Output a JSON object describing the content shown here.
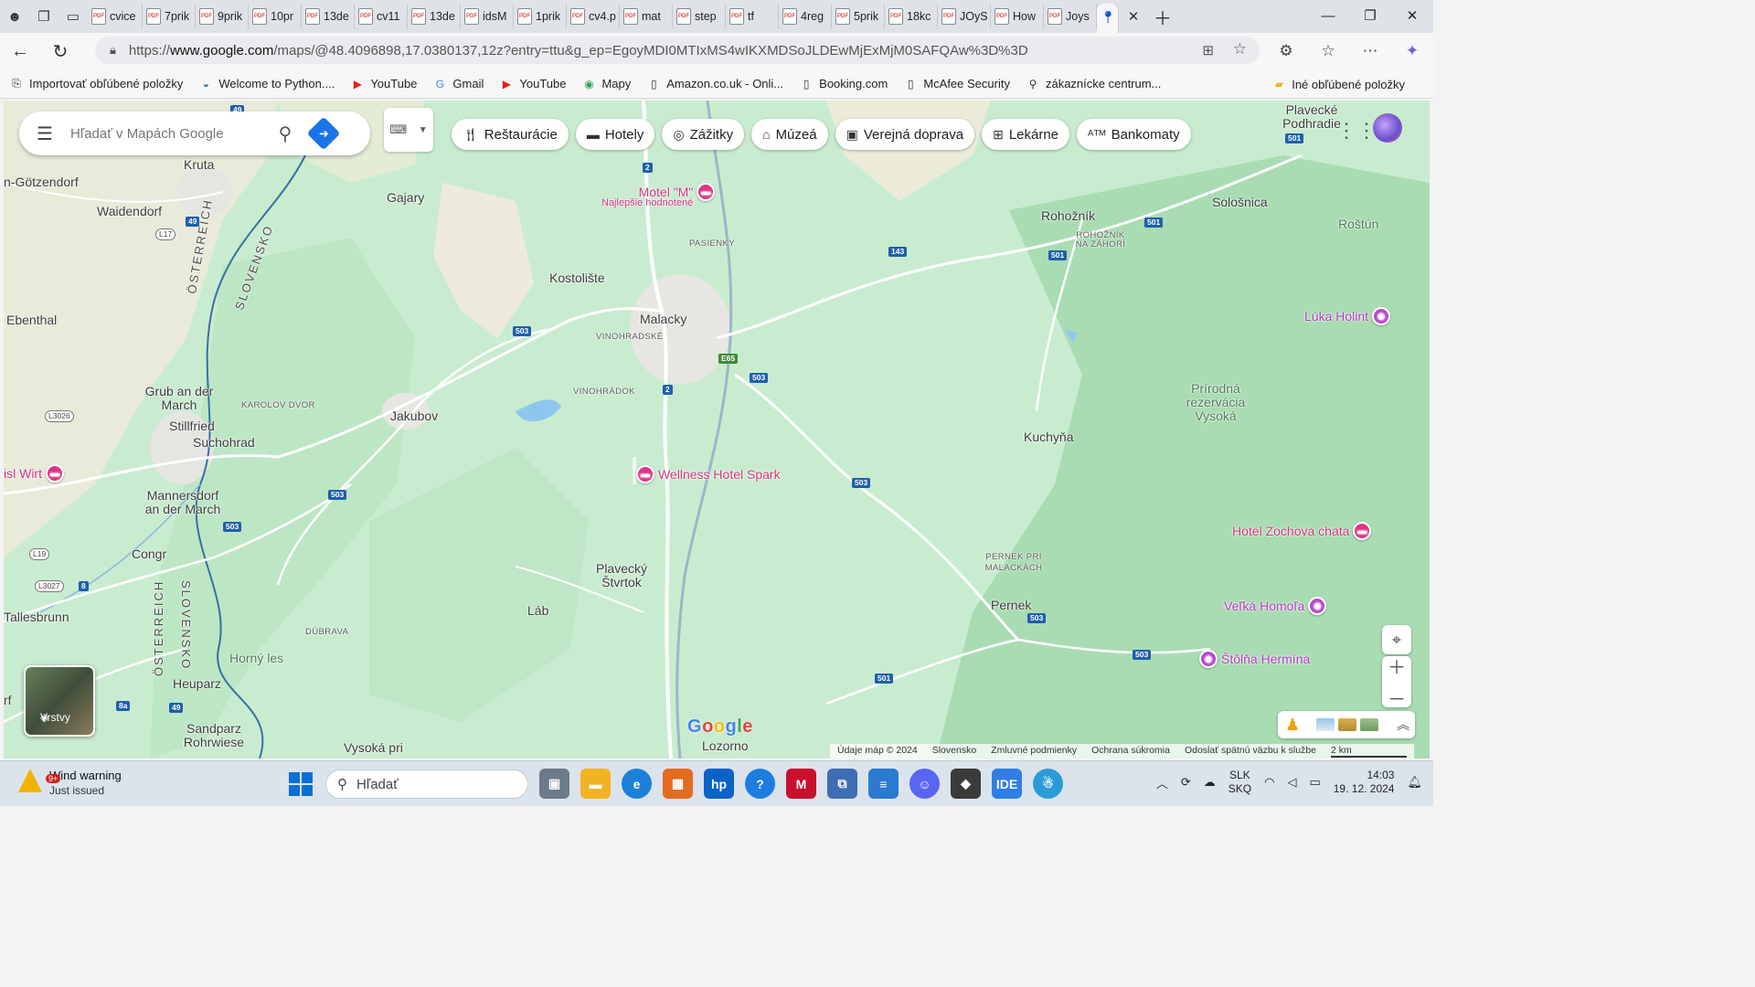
{
  "browser": {
    "tabs": [
      {
        "label": "cvice"
      },
      {
        "label": "7prik"
      },
      {
        "label": "9prik"
      },
      {
        "label": "10pr"
      },
      {
        "label": "13de"
      },
      {
        "label": "cv11"
      },
      {
        "label": "13de"
      },
      {
        "label": "idsM"
      },
      {
        "label": "1prik"
      },
      {
        "label": "cv4.p"
      },
      {
        "label": "mat"
      },
      {
        "label": "step"
      },
      {
        "label": "tf"
      },
      {
        "label": "4reg"
      },
      {
        "label": "5prik"
      },
      {
        "label": "18kc"
      },
      {
        "label": "JOyS"
      },
      {
        "label": "How"
      },
      {
        "label": "Joys"
      }
    ],
    "url_prefix": "https://",
    "url_host": "www.google.com",
    "url_rest": "/maps/@48.4096898,17.0380137,12z?entry=ttu&g_ep=EgoyMDI0MTIxMS4wIKXMDSoJLDEwMjExMjM0SAFQAw%3D%3D",
    "bookmarks": [
      {
        "label": "Importovať obľúbené položky",
        "icon": "import-icon"
      },
      {
        "label": "Welcome to Python....",
        "icon": "python-icon"
      },
      {
        "label": "YouTube",
        "icon": "youtube-icon"
      },
      {
        "label": "Gmail",
        "icon": "google-icon"
      },
      {
        "label": "YouTube",
        "icon": "youtube-icon"
      },
      {
        "label": "Mapy",
        "icon": "maps-icon"
      },
      {
        "label": "Amazon.co.uk - Onli...",
        "icon": "page-icon"
      },
      {
        "label": "Booking.com",
        "icon": "page-icon"
      },
      {
        "label": "McAfee Security",
        "icon": "page-icon"
      },
      {
        "label": "zákaznícke centrum...",
        "icon": "search-icon"
      }
    ],
    "other_bookmarks": "Iné obľúbené položky"
  },
  "maps": {
    "search_placeholder": "Hľadať v Mapách Google",
    "chips": [
      {
        "label": "Reštaurácie",
        "icon": "fork-knife-icon"
      },
      {
        "label": "Hotely",
        "icon": "bed-icon"
      },
      {
        "label": "Zážitky",
        "icon": "camera-icon"
      },
      {
        "label": "Múzeá",
        "icon": "museum-icon"
      },
      {
        "label": "Verejná doprava",
        "icon": "train-icon"
      },
      {
        "label": "Lekárne",
        "icon": "pharmacy-icon"
      },
      {
        "label": "Bankomaty",
        "icon": "atm-icon"
      }
    ],
    "layers_label": "Vrstvy",
    "branding": "Google",
    "footer": [
      "Údaje máp © 2024",
      "Slovensko",
      "Zmluvné podmienky",
      "Ochrana súkromia",
      "Odoslať spätnú väzbu k službe",
      "2 km"
    ],
    "places": {
      "kruta": "Kruta",
      "gotzendorf": "n-Götzendorf",
      "waidendorf": "Waidendorf",
      "gajary": "Gajary",
      "ebenthal": "Ebenthal",
      "kostoliste": "Kostolište",
      "malacky": "Malacky",
      "vinohradske": "VINOHRADSKÉ",
      "pasienky": "PASIENKY",
      "rohoznik": "Rohožník",
      "rohoznik_na_zahori": "ROHOŽNÍK NA ZÁHORÍ",
      "solosnica": "Sološnica",
      "rostun": "Roštún",
      "plavecke_podhradie": "Plavecké Podhradie",
      "grub": "Grub an der March",
      "karolov_dvor": "KAROLOV DVOR",
      "jakubov": "Jakubov",
      "vinohradok": "VINOHRÁDOK",
      "stillfried": "Stillfried",
      "suchohrad": "Suchohrad",
      "kuchyna": "Kuchyňa",
      "rezervacia": "Prírodná rezervácia Vysoká",
      "mannersdorf": "Mannersdorf an der March",
      "congr": "Congr",
      "plavecky_stvrtok": "Plavecký Štvrtok",
      "lab": "Láb",
      "pernek_pri": "PERNEK PRI MALACKÁCH",
      "pernek": "Pernek",
      "tallesbrunn": "Tallesbrunn",
      "dubrava": "DÚBRAVA",
      "horny_les": "Horný les",
      "heuparz": "Heuparz",
      "sandparz": "Sandparz Rohrwiese",
      "vysoka_pri": "Vysoká pri",
      "lozorno": "Lozorno",
      "rf": "rf",
      "osterreich1": "ÖSTERREICH",
      "slovensko1": "SLOVENSKO",
      "osterreich2": "ÖSTERREICH",
      "slovensko2": "SLOVENSKO"
    },
    "pois": {
      "motel_m": "Motel \"M\"",
      "motel_m_sub": "Najlepšie hodnotené",
      "wellness": "Wellness Hotel Spark",
      "wirt": "isl Wirt",
      "luka_holint": "Lúka Holint",
      "zochova": "Hotel Zochova chata",
      "velka_homola": "Veľká Homoľa",
      "stolna": "Štôlňa Hermína"
    },
    "road_shields": {
      "r49a": "49",
      "r2a": "2",
      "r143": "143",
      "r501a": "501",
      "r501b": "501",
      "r501top": "501",
      "r49b": "49",
      "l17": "L17",
      "r503a": "503",
      "e65": "E65",
      "r503b": "503",
      "r2b": "2",
      "l3026": "L3026",
      "r503c": "503",
      "r503d": "503",
      "r503e": "503",
      "l19": "L19",
      "l3027": "L3027",
      "r8": "8",
      "r503f": "503",
      "r503g": "503",
      "r501c": "501",
      "r8a": "8a",
      "r49c": "49"
    }
  },
  "taskbar": {
    "weather_title": "Wind warning",
    "weather_sub": "Just issued",
    "weather_badge": "9+",
    "search_placeholder": "Hľadať",
    "lang_top": "SLK",
    "lang_bottom": "SKQ",
    "time": "14:03",
    "date": "19. 12. 2024"
  }
}
